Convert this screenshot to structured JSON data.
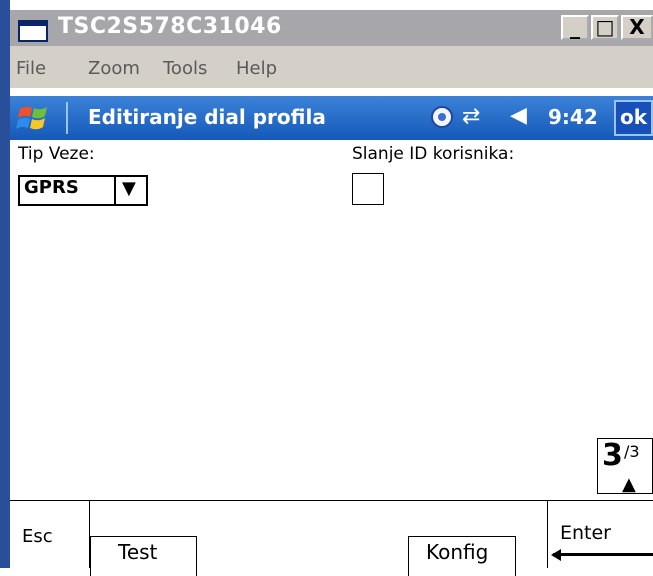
{
  "window": {
    "title": "TSC2S578C31046",
    "minimize": "_",
    "maximize": "□",
    "close": "X"
  },
  "menu": {
    "file": "File",
    "zoom": "Zoom",
    "tools": "Tools",
    "help": "Help"
  },
  "navbar": {
    "title": "Editiranje dial profila",
    "time": "9:42",
    "ok": "ok"
  },
  "form": {
    "tip_veze_label": "Tip Veze:",
    "tip_veze_value": "GPRS",
    "slanje_label": "Slanje ID korisnika:",
    "slanje_checked": false
  },
  "page_indicator": {
    "current": "3",
    "total": "/3"
  },
  "softkeys": {
    "esc": "Esc",
    "test": "Test",
    "konfig": "Konfig",
    "enter": "Enter"
  },
  "colors": {
    "navbar": "#1459b8",
    "titlebar": "#a7a6aa"
  }
}
